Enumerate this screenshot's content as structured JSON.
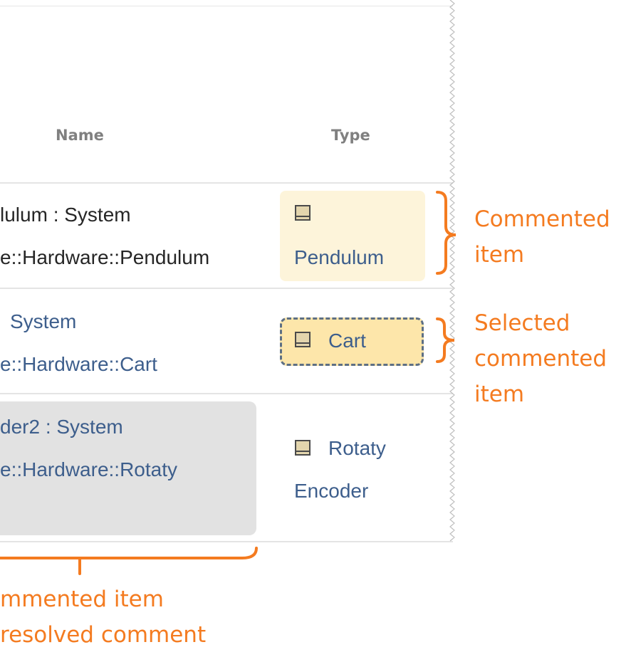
{
  "table": {
    "headers": {
      "name": "Name",
      "type": "Type"
    },
    "rows": [
      {
        "name_line1": "lulum : System",
        "name_line2": "e::Hardware::Pendulum",
        "type_label": "Pendulum"
      },
      {
        "name_line1": "System",
        "name_line2": "e::Hardware::Cart",
        "type_label": "Cart"
      },
      {
        "name_line1": "der2 : System",
        "name_line2": "e::Hardware::Rotaty",
        "type_line1": "Rotaty",
        "type_line2": "Encoder"
      }
    ]
  },
  "annotations": {
    "commented_line1": "Commented",
    "commented_line2": "item",
    "selected_line1": "Selected",
    "selected_line2": "commented",
    "selected_line3": "item",
    "resolved_line1": "mmented item",
    "resolved_line2": "resolved comment"
  },
  "colors": {
    "annotation": "#f47b20",
    "commented_bg": "#fdf4da",
    "selected_bg": "#fde6aa",
    "resolved_bg": "#e2e2e2",
    "link_blue": "#3d5e8c"
  },
  "icons": [
    "block-icon"
  ]
}
